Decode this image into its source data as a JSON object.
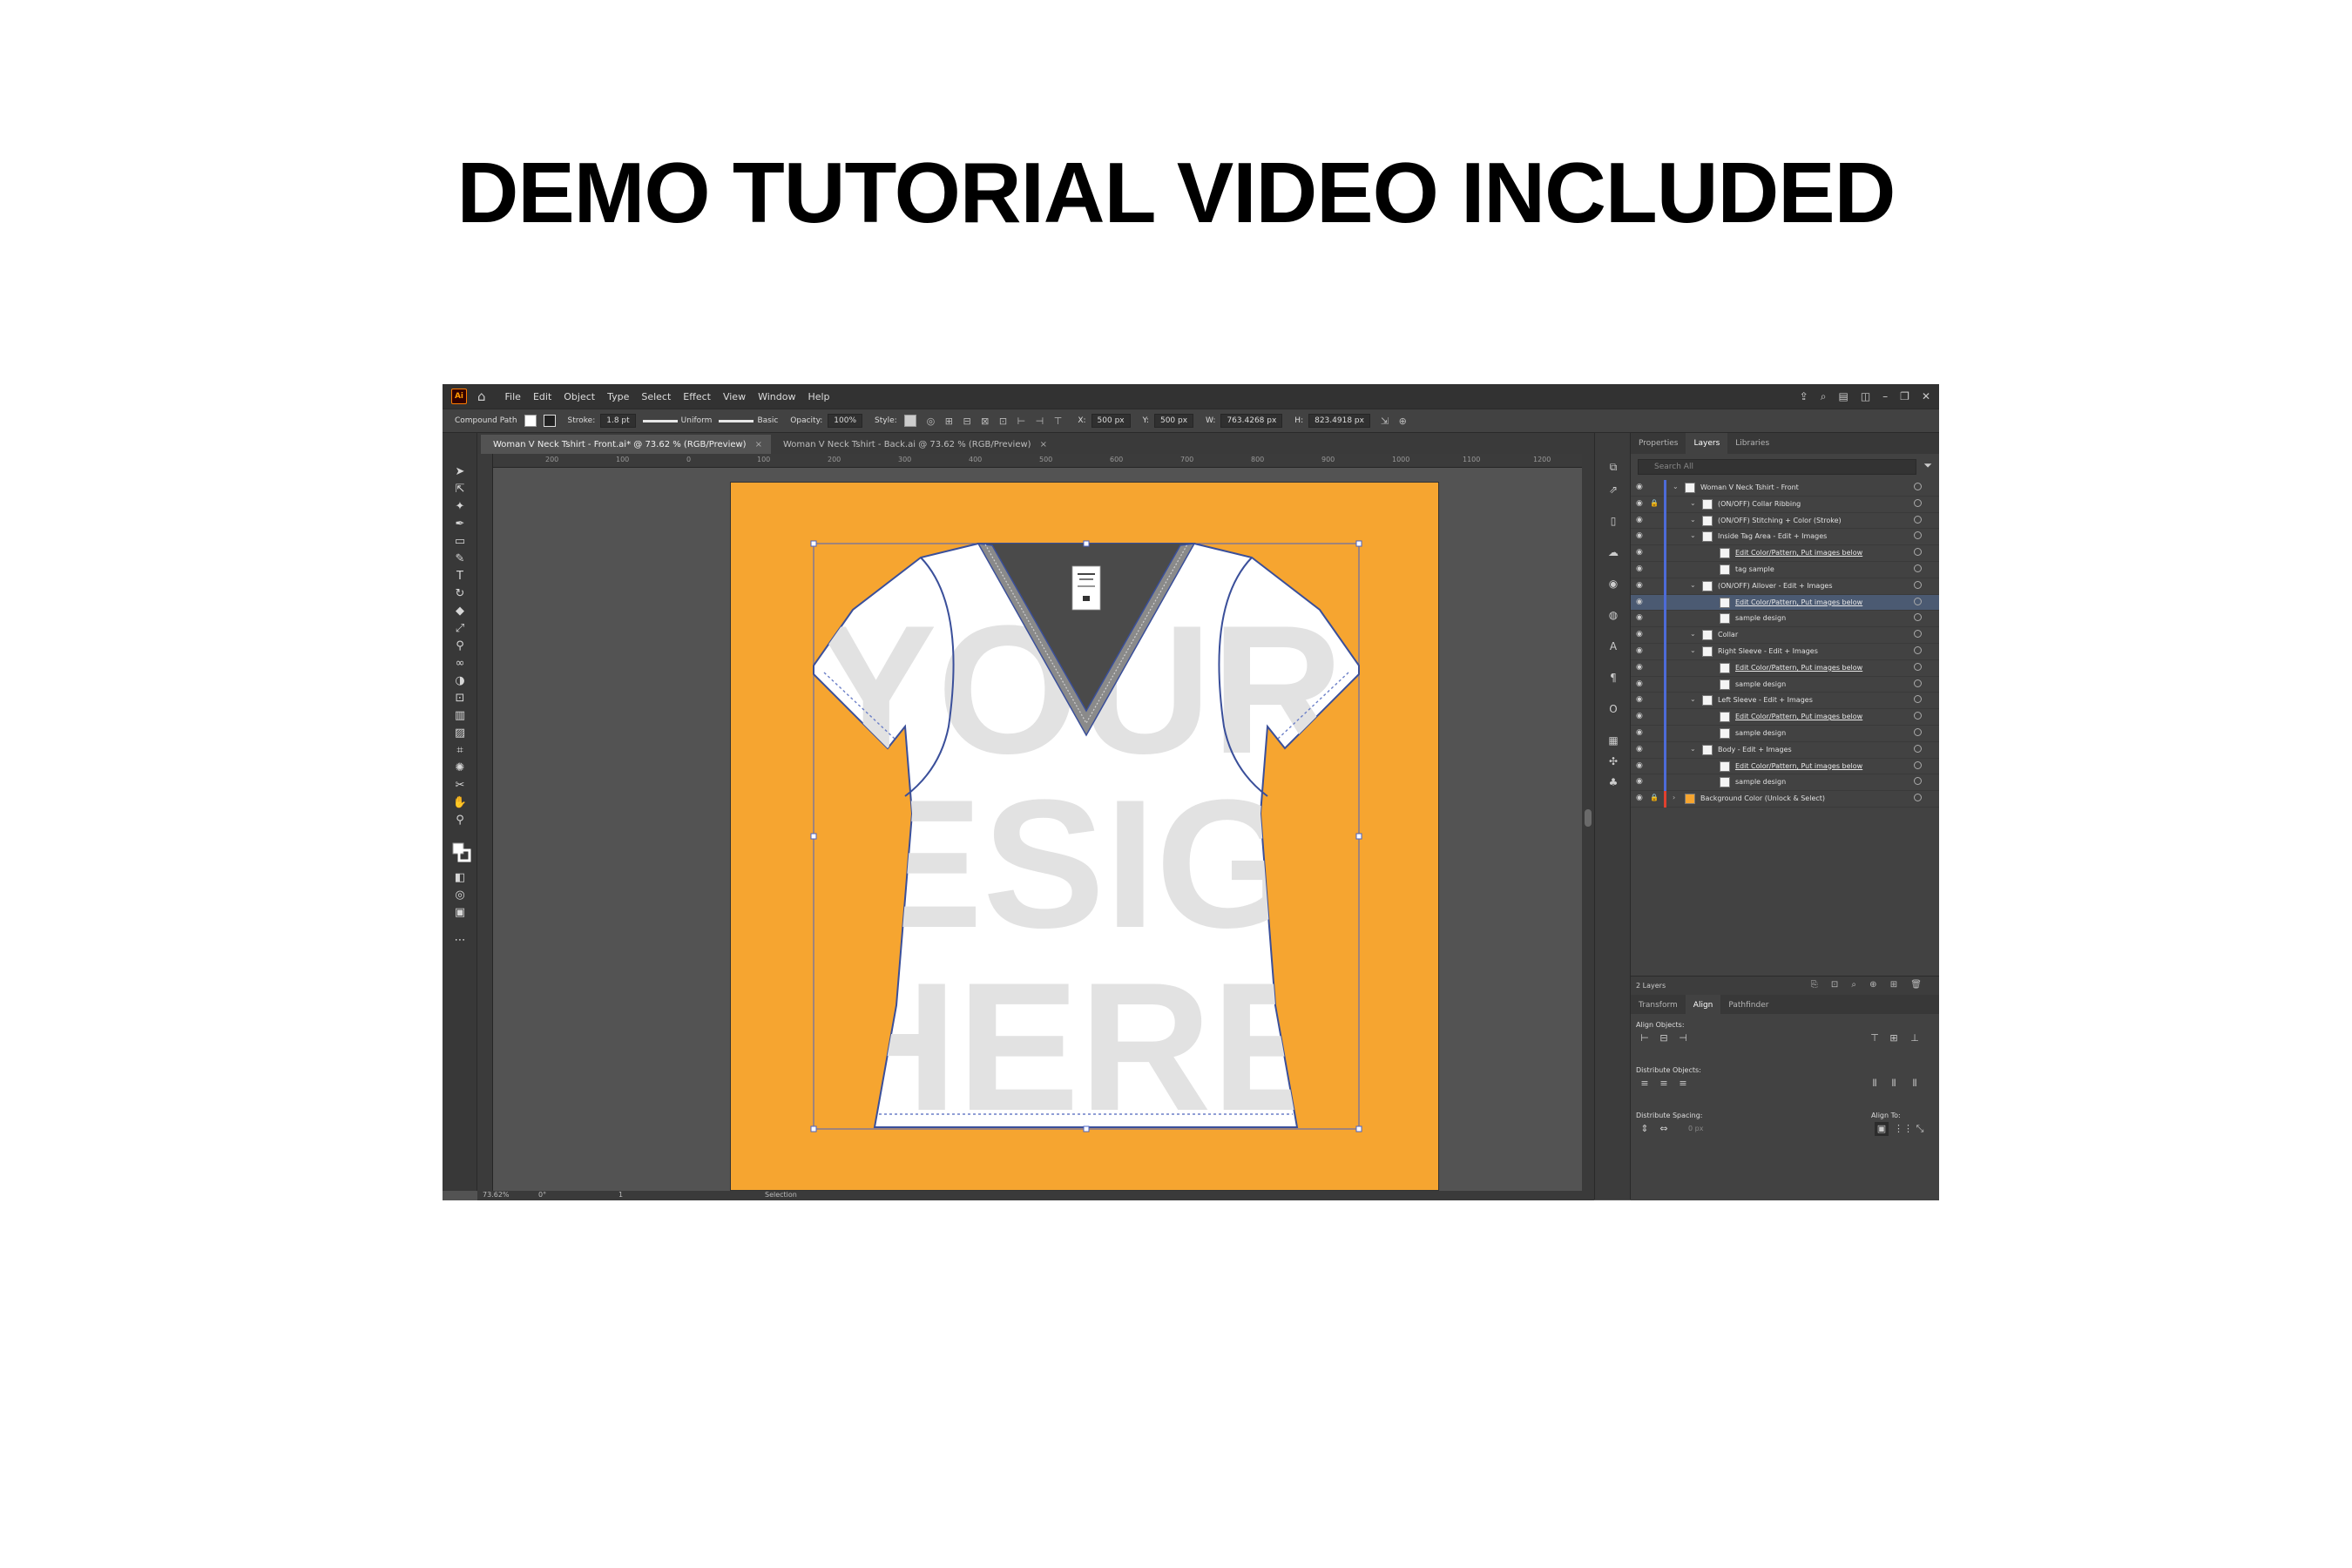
{
  "headline": "DEMO TUTORIAL VIDEO INCLUDED",
  "menu": {
    "logo": "Ai",
    "items": [
      "File",
      "Edit",
      "Object",
      "Type",
      "Select",
      "Effect",
      "View",
      "Window",
      "Help"
    ]
  },
  "control_bar": {
    "selection_type": "Compound Path",
    "stroke_label": "Stroke:",
    "stroke_value": "1.8 pt",
    "profile": "Uniform",
    "brush": "Basic",
    "opacity_label": "Opacity:",
    "opacity_value": "100%",
    "style_label": "Style:",
    "x_label": "X:",
    "x_value": "500 px",
    "y_label": "Y:",
    "y_value": "500 px",
    "w_label": "W:",
    "w_value": "763.4268 px",
    "h_label": "H:",
    "h_value": "823.4918 px"
  },
  "tabs": [
    {
      "label": "Woman V Neck Tshirt - Front.ai* @ 73.62 % (RGB/Preview)"
    },
    {
      "label": "Woman V Neck Tshirt - Back.ai @ 73.62 % (RGB/Preview)"
    }
  ],
  "ruler_labels": [
    "200",
    "100",
    "0",
    "100",
    "200",
    "300",
    "400",
    "500",
    "600",
    "700",
    "800",
    "900",
    "1000",
    "1100",
    "1200"
  ],
  "artboard": {
    "background_color": "#f6a530",
    "shirt_color": "#ffffff",
    "neck_color": "#4a4a4a",
    "outline_color": "#3a4f9a",
    "watermark": [
      "YOUR",
      "DESIGN",
      "HERE"
    ]
  },
  "panel": {
    "tabs": [
      "Properties",
      "Layers",
      "Libraries"
    ],
    "active_tab": "Layers",
    "search_placeholder": "Search All",
    "layers": [
      {
        "name": "Woman V Neck Tshirt - Front",
        "indent": 0,
        "locked": false,
        "link": false
      },
      {
        "name": "(ON/OFF) Collar Ribbing",
        "indent": 1,
        "locked": true,
        "link": false
      },
      {
        "name": "(ON/OFF) Stitching + Color (Stroke)",
        "indent": 1,
        "locked": false,
        "link": false
      },
      {
        "name": "Inside Tag Area - Edit + Images",
        "indent": 1,
        "locked": false,
        "link": false
      },
      {
        "name": "Edit Color/Pattern, Put images below",
        "indent": 2,
        "locked": false,
        "link": true
      },
      {
        "name": "tag sample",
        "indent": 2,
        "locked": false,
        "link": false
      },
      {
        "name": "(ON/OFF) Allover - Edit + Images",
        "indent": 1,
        "locked": false,
        "link": false
      },
      {
        "name": "Edit Color/Pattern, Put images below",
        "indent": 2,
        "locked": false,
        "link": true
      },
      {
        "name": "sample design",
        "indent": 2,
        "locked": false,
        "link": false
      },
      {
        "name": "Collar",
        "indent": 1,
        "locked": false,
        "link": false
      },
      {
        "name": "Right Sleeve - Edit + Images",
        "indent": 1,
        "locked": false,
        "link": false
      },
      {
        "name": "Edit Color/Pattern, Put images below",
        "indent": 2,
        "locked": false,
        "link": true
      },
      {
        "name": "sample design",
        "indent": 2,
        "locked": false,
        "link": false
      },
      {
        "name": "Left Sleeve - Edit + Images",
        "indent": 1,
        "locked": false,
        "link": false
      },
      {
        "name": "Edit Color/Pattern, Put images below",
        "indent": 2,
        "locked": false,
        "link": true
      },
      {
        "name": "sample design",
        "indent": 2,
        "locked": false,
        "link": false
      },
      {
        "name": "Body - Edit + Images",
        "indent": 1,
        "locked": false,
        "link": false
      },
      {
        "name": "Edit Color/Pattern, Put images below",
        "indent": 2,
        "locked": false,
        "link": true
      },
      {
        "name": "sample design",
        "indent": 2,
        "locked": false,
        "link": false
      },
      {
        "name": "Background Color (Unlock & Select)",
        "indent": 0,
        "locked": true,
        "link": false
      }
    ],
    "selected_layer_index": 7,
    "layer_count": "2 Layers",
    "lower_tabs": [
      "Transform",
      "Align",
      "Pathfinder"
    ],
    "active_lower_tab": "Align",
    "align_objects_label": "Align Objects:",
    "distribute_objects_label": "Distribute Objects:",
    "distribute_spacing_label": "Distribute Spacing:",
    "align_to_label": "Align To:",
    "spacing_value": "0 px"
  },
  "status": {
    "zoom": "73.62%",
    "rotation": "0°",
    "artboard_number": "1",
    "tool": "Selection"
  }
}
